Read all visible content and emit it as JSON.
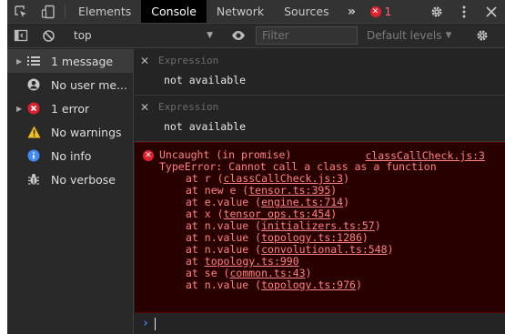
{
  "tabbar": {
    "tabs": [
      {
        "label": "Elements",
        "active": false
      },
      {
        "label": "Console",
        "active": true
      },
      {
        "label": "Network",
        "active": false
      },
      {
        "label": "Sources",
        "active": false
      }
    ],
    "more_label": "»",
    "error_count": "1"
  },
  "toolbar": {
    "context": "top",
    "filter_placeholder": "Filter",
    "levels_label": "Default levels"
  },
  "sidebar": {
    "items": [
      {
        "label": "1 message",
        "icon": "list-icon",
        "expandable": true,
        "selected": true
      },
      {
        "label": "No user me...",
        "icon": "user-icon",
        "expandable": false,
        "selected": false
      },
      {
        "label": "1 error",
        "icon": "error-icon",
        "expandable": true,
        "selected": false
      },
      {
        "label": "No warnings",
        "icon": "warning-icon",
        "expandable": false,
        "selected": false
      },
      {
        "label": "No info",
        "icon": "info-icon",
        "expandable": false,
        "selected": false
      },
      {
        "label": "No verbose",
        "icon": "bug-icon",
        "expandable": false,
        "selected": false
      }
    ]
  },
  "console": {
    "watch": [
      {
        "label": "Expression",
        "value": "not available"
      },
      {
        "label": "Expression",
        "value": "not available"
      }
    ],
    "error": {
      "title": "Uncaught (in promise)",
      "source": "classCallCheck.js:3",
      "message": "TypeError: Cannot call a class as a function",
      "stack": [
        {
          "prefix": "at r (",
          "link": "classCallCheck.js:3",
          "suffix": ")"
        },
        {
          "prefix": "at new e (",
          "link": "tensor.ts:395",
          "suffix": ")"
        },
        {
          "prefix": "at e.value (",
          "link": "engine.ts:714",
          "suffix": ")"
        },
        {
          "prefix": "at x (",
          "link": "tensor_ops.ts:454",
          "suffix": ")"
        },
        {
          "prefix": "at n.value (",
          "link": "initializers.ts:57",
          "suffix": ")"
        },
        {
          "prefix": "at n.value (",
          "link": "topology.ts:1286",
          "suffix": ")"
        },
        {
          "prefix": "at n.value (",
          "link": "convolutional.ts:548",
          "suffix": ")"
        },
        {
          "prefix": "at ",
          "link": "topology.ts:990",
          "suffix": ""
        },
        {
          "prefix": "at se (",
          "link": "common.ts:43",
          "suffix": ")"
        },
        {
          "prefix": "at n.value (",
          "link": "topology.ts:976",
          "suffix": ")"
        }
      ]
    },
    "prompt_symbol": "›"
  },
  "colors": {
    "error_text": "#ff8080",
    "error_background": "#290000",
    "accent_blue": "#3f8bf2",
    "error_red": "#e0202f"
  }
}
